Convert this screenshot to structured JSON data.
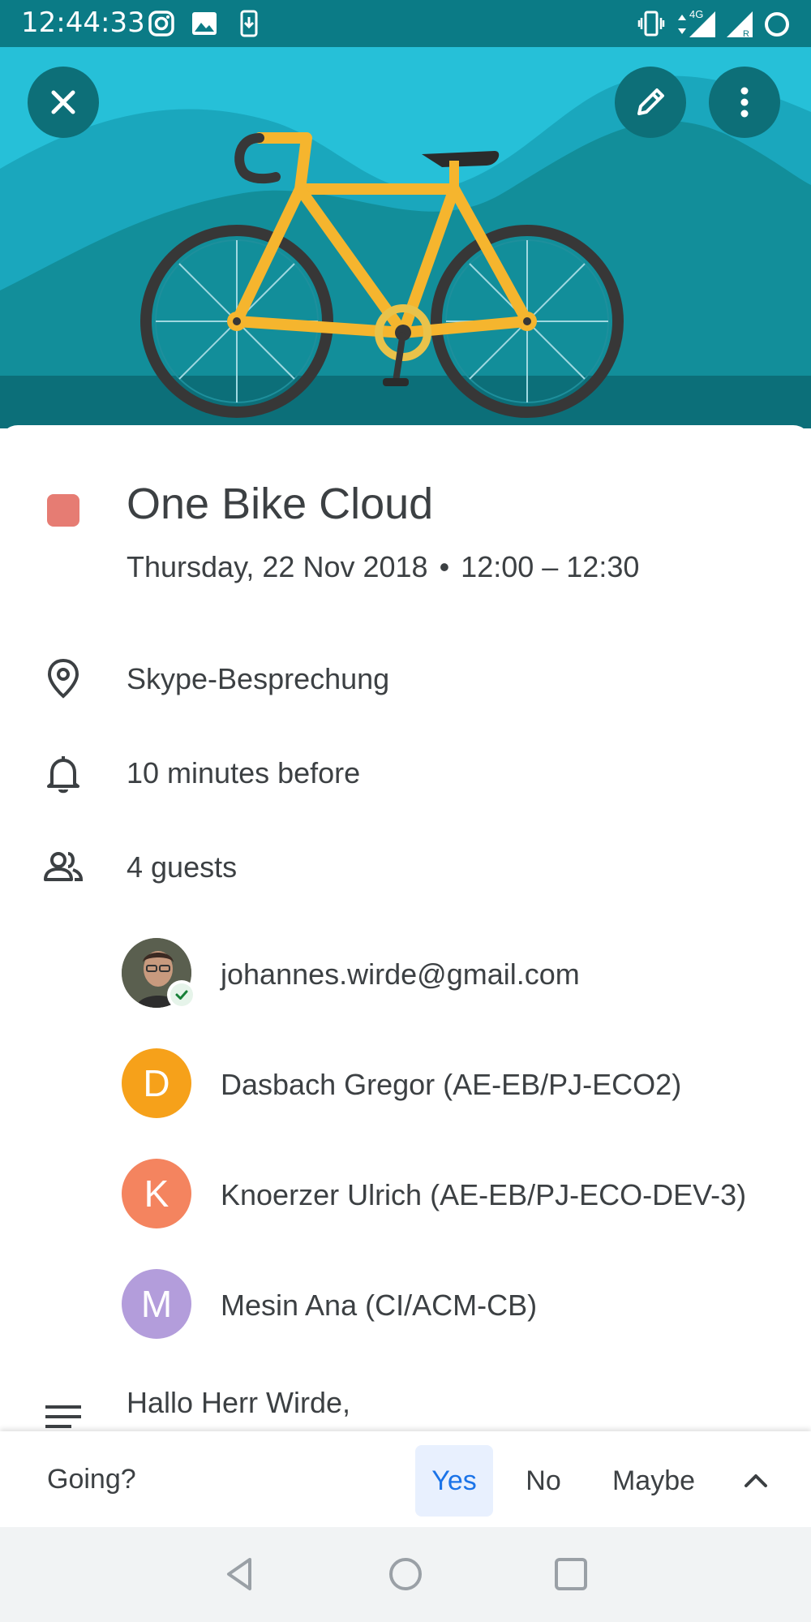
{
  "status_bar": {
    "time": "12:44:33",
    "icons": [
      "instagram-icon",
      "image-icon",
      "download-icon",
      "vibrate-icon",
      "data-arrows-icon",
      "signal-icon",
      "signal-roaming-icon",
      "battery-icon"
    ],
    "network": "4G"
  },
  "header": {
    "illustration": "bicycle-illustration",
    "close_icon": "close-icon",
    "edit_icon": "pencil-icon",
    "more_icon": "more-vert-icon"
  },
  "event": {
    "color": "#e67c73",
    "title": "One Bike Cloud",
    "date": "Thursday, 22 Nov 2018",
    "separator": "•",
    "time_range": "12:00 – 12:30",
    "location": "Skype-Besprechung",
    "reminder": "10 minutes before",
    "guests_count": "4 guests",
    "guests": [
      {
        "name": "johannes.wirde@gmail.com",
        "initial": "",
        "color": "#6d6a5e",
        "accepted": true
      },
      {
        "name": "Dasbach Gregor (AE-EB/PJ-ECO2)",
        "initial": "D",
        "color": "#f6a11a"
      },
      {
        "name": "Knoerzer Ulrich (AE-EB/PJ-ECO-DEV-3)",
        "initial": "K",
        "color": "#f4845f"
      },
      {
        "name": "Mesin Ana (CI/ACM-CB)",
        "initial": "M",
        "color": "#b39ddb"
      }
    ],
    "description": "Hallo Herr Wirde,"
  },
  "rsvp": {
    "prompt": "Going?",
    "yes": "Yes",
    "no": "No",
    "maybe": "Maybe",
    "selected": "Yes"
  },
  "colors": {
    "status_bar": "#0b7b86",
    "header_bg": "#26c0d8",
    "accent": "#1a73e8"
  }
}
